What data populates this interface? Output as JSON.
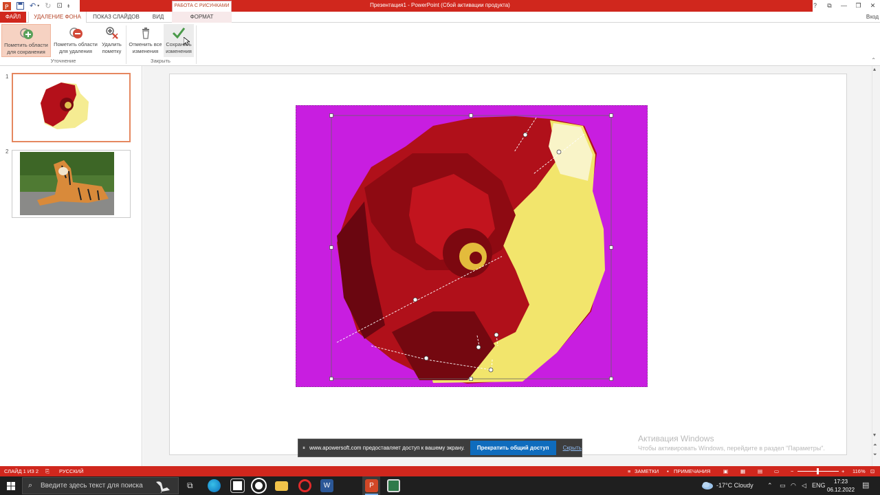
{
  "window": {
    "title": "Презентация1 - PowerPoint (Сбой активации продукта)",
    "context_group": "РАБОТА С РИСУНКАМИ",
    "login": "Вход",
    "controls": [
      "?",
      "⧉",
      "—",
      "❐",
      "✕"
    ]
  },
  "tabs": {
    "file": "ФАЙЛ",
    "background_removal": "УДАЛЕНИЕ ФОНА",
    "slideshow": "ПОКАЗ СЛАЙДОВ",
    "view": "ВИД",
    "format": "ФОРМАТ"
  },
  "ribbon": {
    "mark_keep_1": "Пометить области",
    "mark_keep_2": "для сохранения",
    "mark_remove_1": "Пометить области",
    "mark_remove_2": "для удаления",
    "delete_mark_1": "Удалить",
    "delete_mark_2": "пометку",
    "discard_1": "Отменить все",
    "discard_2": "изменения",
    "keep_1": "Сохранить",
    "keep_2": "изменения",
    "group_refine": "Уточнение",
    "group_close": "Закрыть"
  },
  "slides": {
    "num1": "1",
    "num2": "2"
  },
  "share_banner": {
    "message": "www.apowersoft.com предоставляет доступ к вашему экрану.",
    "stop": "Прекратить общий доступ",
    "hide": "Скрыть"
  },
  "activation": {
    "title": "Активация Windows",
    "subtitle": "Чтобы активировать Windows, перейдите в раздел \"Параметры\"."
  },
  "statusbar": {
    "slide_info": "СЛАЙД 1 ИЗ 2",
    "language": "РУССКИЙ",
    "notes": "ЗАМЕТКИ",
    "comments": "ПРИМЕЧАНИЯ",
    "zoom": "116%"
  },
  "taskbar": {
    "search_placeholder": "Введите здесь текст для поиска",
    "weather": "-17°C  Cloudy",
    "lang": "ENG",
    "time": "17:23",
    "date": "06.12.2022"
  },
  "colors": {
    "accent": "#d0271d",
    "selection": "#e5875f",
    "image_background": "#c81ee0"
  }
}
